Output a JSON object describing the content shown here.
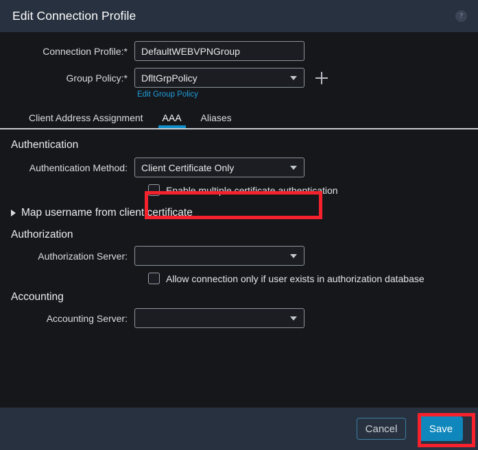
{
  "header": {
    "title": "Edit Connection Profile",
    "help_icon": "question-mark-circle-icon",
    "help_glyph": "?"
  },
  "form": {
    "connection_profile": {
      "label": "Connection Profile:*",
      "value": "DefaultWEBVPNGroup"
    },
    "group_policy": {
      "label": "Group Policy:*",
      "value": "DfltGrpPolicy",
      "add_icon": "plus-icon",
      "edit_link": "Edit Group Policy"
    }
  },
  "tabs": [
    {
      "label": "Client Address Assignment",
      "active": false
    },
    {
      "label": "AAA",
      "active": true
    },
    {
      "label": "Aliases",
      "active": false
    }
  ],
  "authentication": {
    "heading": "Authentication",
    "method": {
      "label": "Authentication Method:",
      "value": "Client Certificate Only",
      "highlighted": true
    },
    "multi_cert": {
      "label": "Enable multiple certificate authentication",
      "checked": false
    },
    "map_username": {
      "label": "Map username from client certificate",
      "expanded": false,
      "icon": "triangle-right-icon"
    }
  },
  "authorization": {
    "heading": "Authorization",
    "server": {
      "label": "Authorization Server:",
      "value": ""
    },
    "allow_only_if_exists": {
      "label": "Allow connection only if user exists in authorization database",
      "checked": false
    }
  },
  "accounting": {
    "heading": "Accounting",
    "server": {
      "label": "Accounting Server:",
      "value": ""
    }
  },
  "footer": {
    "cancel_label": "Cancel",
    "save_label": "Save",
    "save_highlighted": true
  },
  "colors": {
    "header_bg": "#27313f",
    "body_bg": "#16171b",
    "accent_blue": "#0f8fcc",
    "link_blue": "#1f9fdc",
    "save_blue": "#0f87bc",
    "highlight_red": "#f5222d"
  }
}
